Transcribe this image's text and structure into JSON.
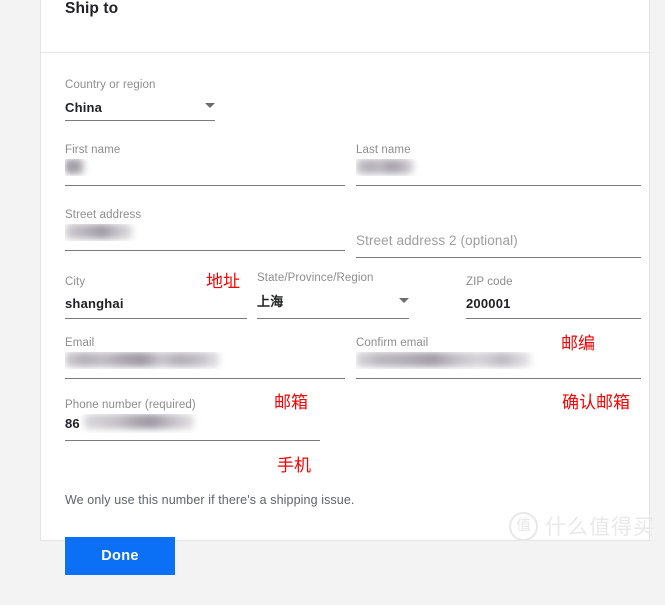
{
  "card": {
    "title": "Ship to"
  },
  "fields": {
    "country": {
      "label": "Country or region",
      "value": "China",
      "caret_icon": "chevron-down-icon"
    },
    "first_name": {
      "label": "First name",
      "value": "",
      "redacted": true
    },
    "last_name": {
      "label": "Last name",
      "value": "",
      "redacted": true
    },
    "street_address": {
      "label": "Street address",
      "value": "",
      "redacted": true
    },
    "street_address_2": {
      "label": "",
      "placeholder": "Street address 2 (optional)",
      "value": ""
    },
    "city": {
      "label": "City",
      "value": "shanghai"
    },
    "state": {
      "label": "State/Province/Region",
      "value": "上海",
      "caret_icon": "chevron-down-icon"
    },
    "zip": {
      "label": "ZIP code",
      "value": "200001"
    },
    "email": {
      "label": "Email",
      "value": "",
      "redacted": true
    },
    "confirm_email": {
      "label": "Confirm email",
      "value": "",
      "redacted": true
    },
    "phone": {
      "label": "Phone number (required)",
      "value": "86",
      "redacted": true
    }
  },
  "annotations": {
    "address": "地址",
    "zip": "邮编",
    "email": "邮箱",
    "confirm_email": "确认邮箱",
    "phone": "手机"
  },
  "helper_text": "We only use this number if there's a shipping issue.",
  "done_button": {
    "label": "Done"
  },
  "watermark": {
    "badge": "值",
    "text": "什么值得买"
  },
  "colors": {
    "accent_blue": "#0b70f5",
    "annotation_red": "#fb0000",
    "label_gray": "#8d8d8d",
    "value_dark": "#202124",
    "page_bg": "#f3f3f3"
  }
}
